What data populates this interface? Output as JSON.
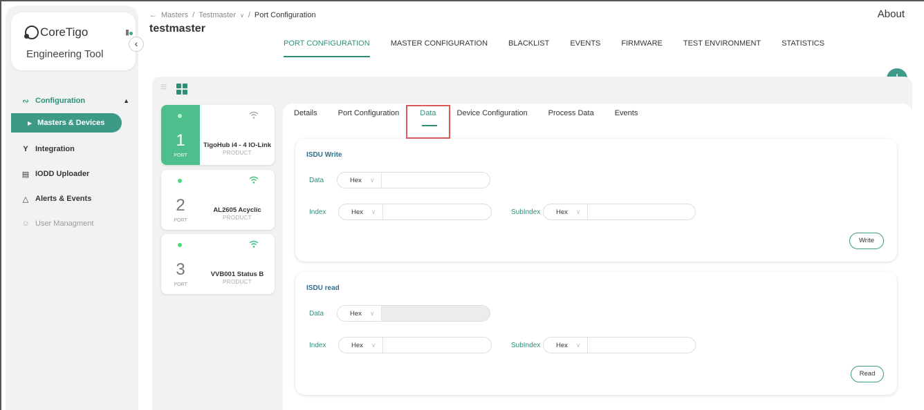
{
  "app": {
    "brand": "CoreTigo",
    "subtitle": "Engineering Tool",
    "about": "About"
  },
  "sidebar": {
    "section_label": "Configuration",
    "active_item": "Masters & Devices",
    "items": [
      {
        "label": "Integration",
        "icon": "integration-icon"
      },
      {
        "label": "IODD Uploader",
        "icon": "document-icon"
      },
      {
        "label": "Alerts & Events",
        "icon": "warning-icon"
      },
      {
        "label": "User Managment",
        "icon": "users-icon"
      }
    ]
  },
  "header": {
    "breadcrumb": [
      "Masters",
      "Testmaster",
      "Port Configuration"
    ],
    "title": "testmaster",
    "tabs": [
      "PORT CONFIGURATION",
      "MASTER CONFIGURATION",
      "BLACKLIST",
      "EVENTS",
      "FIRMWARE",
      "TEST ENVIRONMENT",
      "STATISTICS"
    ],
    "active_tab": "PORT CONFIGURATION"
  },
  "ports": [
    {
      "number": "1",
      "label": "PORT",
      "name": "TigoHub i4 - 4 IO-Link",
      "type": "PRODUCT"
    },
    {
      "number": "2",
      "label": "PORT",
      "name": "AL2605 Acyclic",
      "type": "PRODUCT"
    },
    {
      "number": "3",
      "label": "PORT",
      "name": "VVB001 Status B",
      "type": "PRODUCT"
    }
  ],
  "sub_tabs": [
    "Details",
    "Port Configuration",
    "Data",
    "Device Configuration",
    "Process Data",
    "Events"
  ],
  "active_sub_tab": "Data",
  "isdu_write": {
    "title": "ISDU Write",
    "data_label": "Data",
    "index_label": "Index",
    "subindex_label": "SubIndex",
    "format": "Hex",
    "button": "Write"
  },
  "isdu_read": {
    "title": "ISDU read",
    "data_label": "Data",
    "index_label": "Index",
    "subindex_label": "SubIndex",
    "format": "Hex",
    "button": "Read"
  },
  "colors": {
    "accent": "#2e8f78",
    "active_port": "#4cbf8d",
    "highlight": "#e05a5a"
  }
}
